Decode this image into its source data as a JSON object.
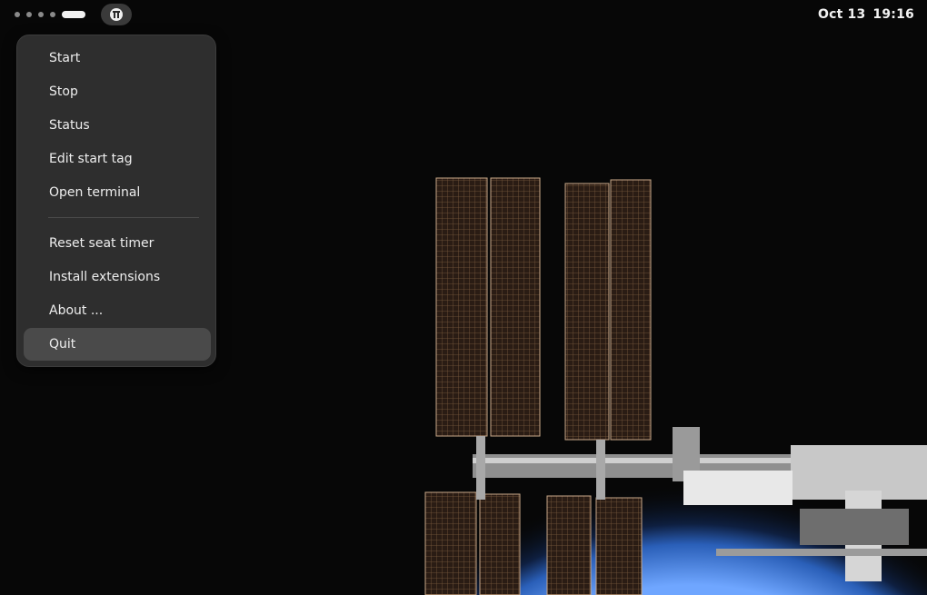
{
  "topbar": {
    "workspaces": {
      "count": 5,
      "active_index": 4
    },
    "tray_icon": "extension-indicator-icon",
    "clock": {
      "date": "Oct 13",
      "time": "19:16"
    }
  },
  "menu": {
    "items": [
      {
        "label": "Start"
      },
      {
        "label": "Stop"
      },
      {
        "label": "Status"
      },
      {
        "label": "Edit start tag"
      },
      {
        "label": "Open terminal"
      },
      {
        "label": "Reset seat timer"
      },
      {
        "label": "Install extensions"
      },
      {
        "label": "About ..."
      },
      {
        "label": "Quit",
        "highlighted": true
      }
    ]
  },
  "colors": {
    "panel_bg": "#2e2e2e",
    "highlight": "#4a4a4a",
    "text": "#eeeeee",
    "earth_blue": "#3f74c8"
  }
}
